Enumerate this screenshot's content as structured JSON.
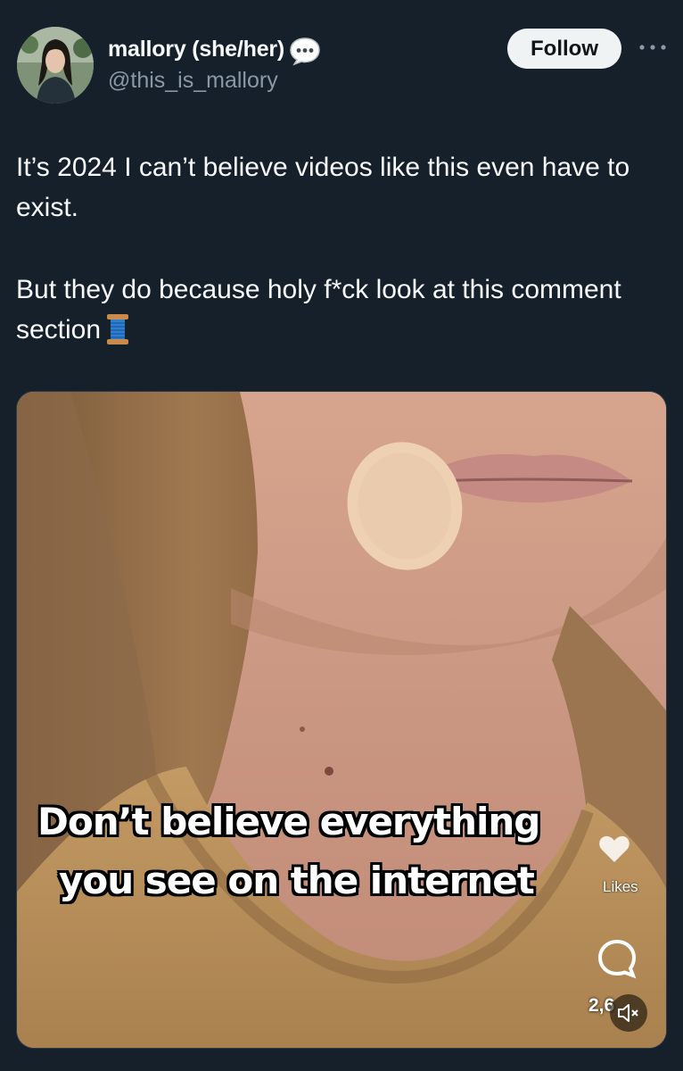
{
  "author": {
    "display_name": "mallory (she/her)",
    "handle": "@this_is_mallory",
    "avatar": "profile-photo",
    "label_icon": "speech-bubble-icon"
  },
  "actions": {
    "follow_label": "Follow",
    "more_icon": "ellipsis-icon"
  },
  "tweet": {
    "paragraph_1": "It’s 2024 I can’t believe videos like this even have to exist.",
    "paragraph_2": "But they do because holy f*ck look at this comment section",
    "trailing_emoji": "spool-of-thread-icon"
  },
  "media": {
    "caption_line_1": "Don’t believe everything",
    "caption_line_2": "you see on the internet",
    "likes_label": "Likes",
    "comment_count": "2,6",
    "comment_icon": "comment-bubble-icon",
    "mute_icon": "speaker-muted-icon"
  },
  "colors": {
    "background": "#15202b",
    "text_primary": "#f7f9f9",
    "text_secondary": "#8b98a5",
    "follow_button_bg": "#eff3f4"
  }
}
